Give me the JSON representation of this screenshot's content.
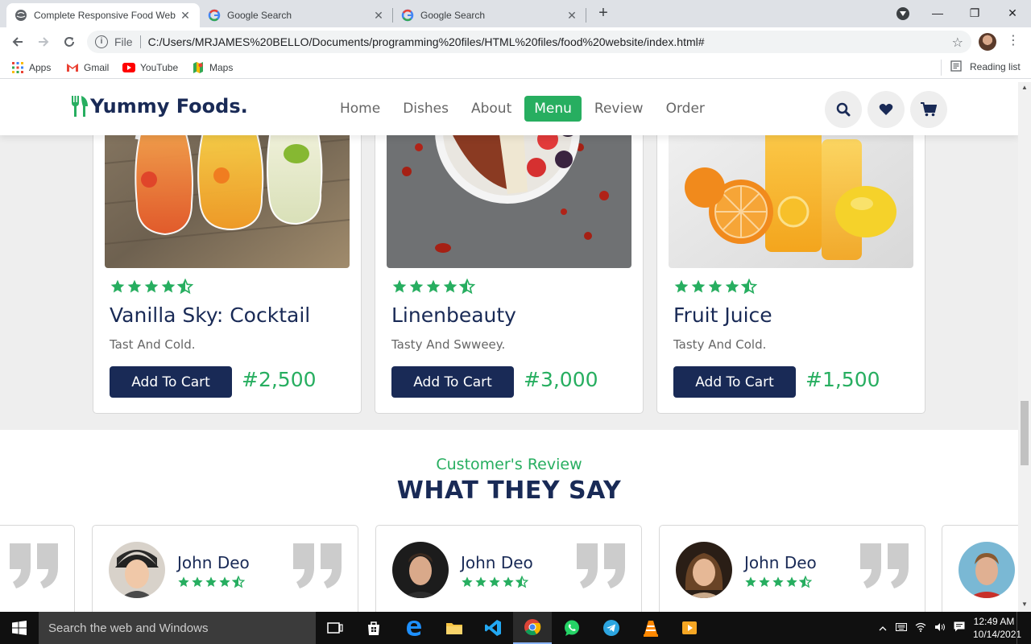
{
  "browser": {
    "tabs": [
      {
        "title": "Complete Responsive Food Web",
        "active": true
      },
      {
        "title": "Google Search",
        "active": false
      },
      {
        "title": "Google Search",
        "active": false
      }
    ],
    "address": {
      "scheme": "File",
      "url": "C:/Users/MRJAMES%20BELLO/Documents/programming%20files/HTML%20files/food%20website/index.html#"
    },
    "bookmarks": [
      {
        "label": "Apps"
      },
      {
        "label": "Gmail"
      },
      {
        "label": "YouTube"
      },
      {
        "label": "Maps"
      }
    ],
    "reading_list": "Reading list"
  },
  "site": {
    "logo": "Yummy Foods.",
    "nav": [
      {
        "label": "Home",
        "active": false
      },
      {
        "label": "Dishes",
        "active": false
      },
      {
        "label": "About",
        "active": false
      },
      {
        "label": "Menu",
        "active": true
      },
      {
        "label": "Review",
        "active": false
      },
      {
        "label": "Order",
        "active": false
      }
    ],
    "header_icons": [
      "search-icon",
      "heart-icon",
      "cart-icon"
    ]
  },
  "menu_items": [
    {
      "name": "Vanilla Sky: Cocktail",
      "desc": "Tast And Cold.",
      "price": "#2,500",
      "button": "Add To Cart",
      "rating": 4.5
    },
    {
      "name": "Linenbeauty",
      "desc": "Tasty And Swweey.",
      "price": "#3,000",
      "button": "Add To Cart",
      "rating": 4.5
    },
    {
      "name": "Fruit Juice",
      "desc": "Tasty And Cold.",
      "price": "#1,500",
      "button": "Add To Cart",
      "rating": 4.5
    }
  ],
  "reviews": {
    "subtitle": "Customer's Review",
    "title": "WHAT THEY SAY",
    "items": [
      {
        "name": "John Deo",
        "rating": 4.5
      },
      {
        "name": "John Deo",
        "rating": 4.5
      },
      {
        "name": "John Deo",
        "rating": 4.5
      }
    ]
  },
  "taskbar": {
    "search_placeholder": "Search the web and Windows",
    "time": "12:49 AM",
    "date": "10/14/2021"
  },
  "colors": {
    "primary_green": "#27ae60",
    "navy": "#192a56",
    "band_gray": "#eeeeee"
  }
}
